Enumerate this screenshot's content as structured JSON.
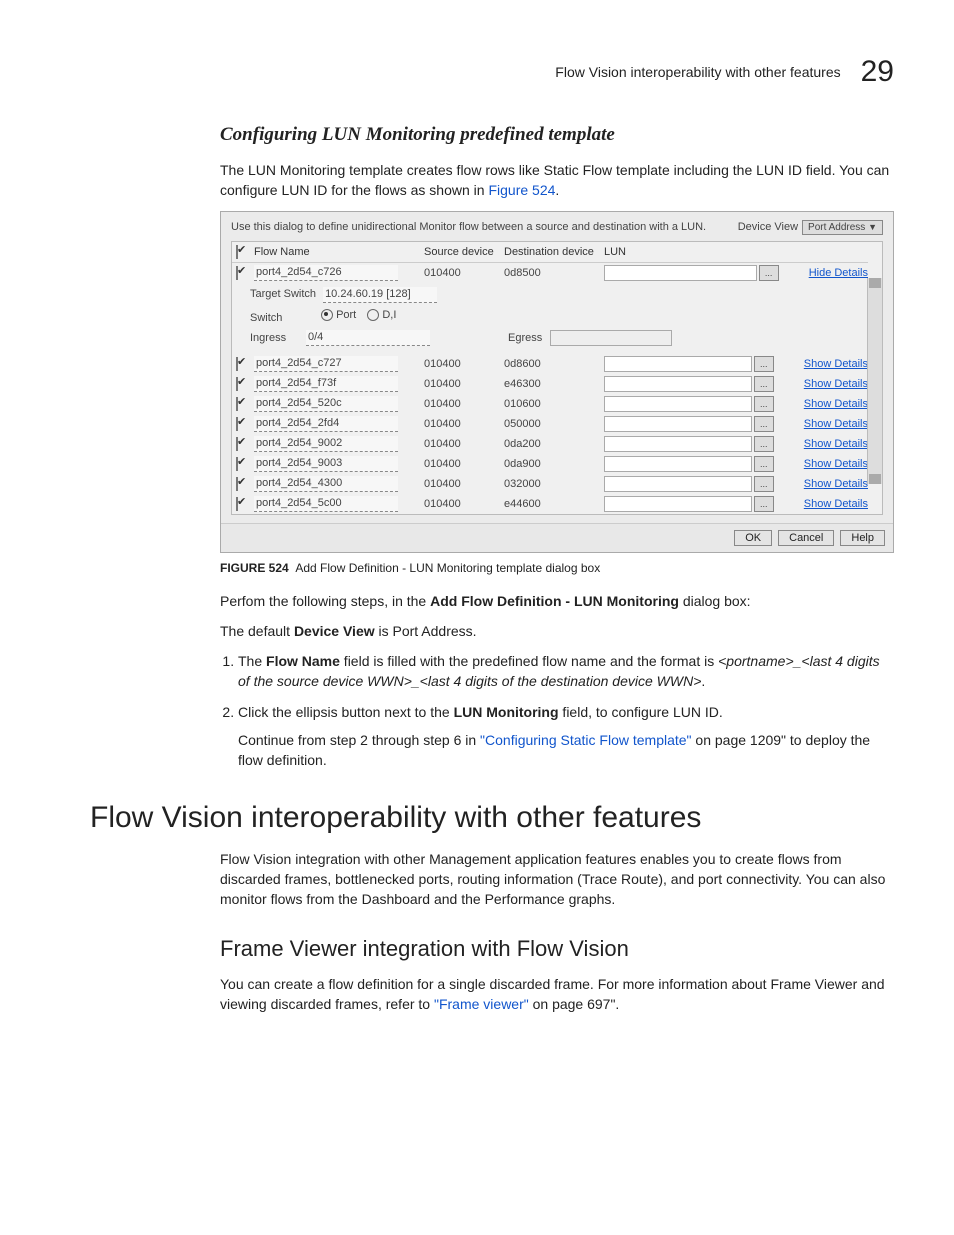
{
  "header": {
    "breadcrumb": "Flow Vision interoperability with other features",
    "chapter": "29"
  },
  "s1": {
    "title": "Configuring LUN Monitoring predefined template",
    "intro1": "The LUN Monitoring template creates flow rows like Static Flow template including the LUN ID field. You can configure LUN ID for the flows as shown in ",
    "fig_link": "Figure 524",
    "intro1_end": "."
  },
  "dialog": {
    "desc": "Use this dialog to define unidirectional Monitor flow between a source and destination with a LUN.",
    "deviceview_lbl": "Device View",
    "deviceview_val": "Port Address",
    "cols": {
      "name": "Flow Name",
      "src": "Source device",
      "dst": "Destination device",
      "lun": "LUN"
    },
    "top_row": {
      "name": "port4_2d54_c726",
      "src": "010400",
      "dst": "0d8500",
      "action": "Hide Details"
    },
    "target_lbl": "Target Switch",
    "target_val": "10.24.60.19 [128]",
    "switch_lbl": "Switch",
    "port_lbl": "Port",
    "dj_lbl": "D,I",
    "ingress_lbl": "Ingress",
    "ingress_val": "0/4",
    "egress_lbl": "Egress",
    "rows": [
      {
        "name": "port4_2d54_c727",
        "src": "010400",
        "dst": "0d8600",
        "action": "Show Details"
      },
      {
        "name": "port4_2d54_f73f",
        "src": "010400",
        "dst": "e46300",
        "action": "Show Details"
      },
      {
        "name": "port4_2d54_520c",
        "src": "010400",
        "dst": "010600",
        "action": "Show Details"
      },
      {
        "name": "port4_2d54_2fd4",
        "src": "010400",
        "dst": "050000",
        "action": "Show Details"
      },
      {
        "name": "port4_2d54_9002",
        "src": "010400",
        "dst": "0da200",
        "action": "Show Details"
      },
      {
        "name": "port4_2d54_9003",
        "src": "010400",
        "dst": "0da900",
        "action": "Show Details"
      },
      {
        "name": "port4_2d54_4300",
        "src": "010400",
        "dst": "032000",
        "action": "Show Details"
      },
      {
        "name": "port4_2d54_5c00",
        "src": "010400",
        "dst": "e44600",
        "action": "Show Details"
      }
    ],
    "ok": "OK",
    "cancel": "Cancel",
    "help": "Help"
  },
  "figcap": {
    "num": "FIGURE 524",
    "txt": "Add Flow Definition - LUN Monitoring template dialog box"
  },
  "steps": {
    "intro_a": "Perfom the following steps, in the ",
    "intro_b": "Add Flow Definition - LUN Monitoring",
    "intro_c": " dialog box:",
    "default_a": "The default ",
    "default_b": "Device View",
    "default_c": " is Port Address.",
    "s1_a": "The ",
    "s1_b": "Flow Name",
    "s1_c": " field is filled with the predefined flow name and the format is ",
    "s1_d": "<portname>_<last 4 digits of the source device WWN>_<last 4 digits of the destination device WWN>",
    "s1_e": ".",
    "s2_a": "Click the ellipsis button next to the ",
    "s2_b": "LUN Monitoring",
    "s2_c": " field, to configure LUN ID.",
    "s2_cont_a": "Continue from step 2 through step 6 in ",
    "s2_cont_link": "\"Configuring Static Flow template\"",
    "s2_cont_b": " on page 1209\" to deploy the flow definition."
  },
  "h1": "Flow Vision interoperability with other features",
  "p_interop": "Flow Vision integration with other Management application features enables you to create flows from discarded frames, bottlenecked ports, routing information (Trace Route), and port connectivity. You can also monitor flows from the Dashboard and the Performance graphs.",
  "h2": "Frame Viewer integration with Flow Vision",
  "p_fv_a": "You can create a flow definition for a single discarded frame. For more information about Frame Viewer and viewing discarded frames, refer to ",
  "p_fv_link": "\"Frame viewer\"",
  "p_fv_b": " on page 697\"."
}
